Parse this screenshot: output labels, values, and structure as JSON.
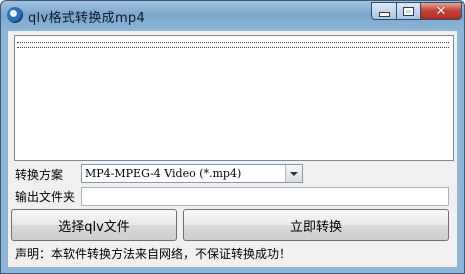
{
  "window": {
    "title": "qlv格式转换成mp4",
    "controls": {
      "minimize": "minimize-icon",
      "maximize": "maximize-icon",
      "close": "close-icon"
    }
  },
  "form": {
    "scheme_label": "转换方案",
    "scheme_value": "MP4-MPEG-4 Video (*.mp4)",
    "output_label": "输出文件夹",
    "output_value": ""
  },
  "buttons": {
    "select_label": "选择qlv文件",
    "convert_label": "立即转换"
  },
  "status": {
    "text": "声明：本软件转换方法来自网络，不保证转换成功！"
  }
}
